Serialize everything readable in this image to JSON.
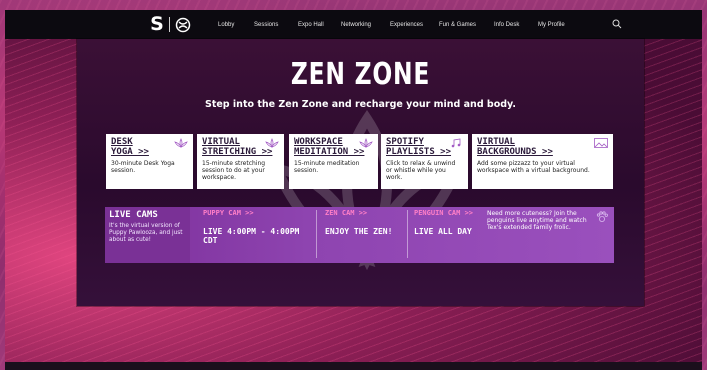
{
  "nav": {
    "items": [
      "Lobby",
      "Sessions",
      "Expo Hall",
      "Networking",
      "Experiences",
      "Fun & Games",
      "Info Desk",
      "My Profile"
    ],
    "logo_letter": "S"
  },
  "page": {
    "title": "ZEN ZONE",
    "subtitle": "Step into the Zen Zone and recharge your mind and body."
  },
  "cards": [
    {
      "title_line1": "DESK",
      "title_line2": "YOGA >>",
      "desc": "30-minute Desk Yoga session.",
      "icon": "lotus-icon"
    },
    {
      "title_line1": "VIRTUAL",
      "title_line2": "STRETCHING >>",
      "desc": "15-minute stretching session to do at your workspace.",
      "icon": "lotus-icon"
    },
    {
      "title_line1": "WORKSPACE",
      "title_line2": "MEDITATION >>",
      "desc": "15-minute meditation session.",
      "icon": "lotus-icon"
    },
    {
      "title_line1": "SPOTIFY",
      "title_line2": "PLAYLISTS >>",
      "desc": "Click to relax & unwind or whistle while you work.",
      "icon": "music-note-icon"
    },
    {
      "title_line1": "VIRTUAL",
      "title_line2": "BACKGROUNDS >>",
      "desc": "Add some pizzazz to your virtual workspace with a virtual background.",
      "icon": "image-icon"
    }
  ],
  "live_cams": {
    "title": "LIVE CAMS",
    "desc": "It's the virtual version of Puppy Pawlooza, and just about as cute!",
    "cams": [
      {
        "label": "PUPPY CAM >>",
        "sub": "LIVE 4:00PM - 4:00PM CDT"
      },
      {
        "label": "ZEN CAM >>",
        "sub": "ENJOY THE ZEN!"
      },
      {
        "label": "PENGUIN CAM >>",
        "sub": "LIVE ALL DAY"
      }
    ],
    "penguin_desc": "Need more cuteness? Join the penguins live anytime and watch Tex's extended family frolic."
  },
  "colors": {
    "nav_bg": "#0c0a10",
    "panel_bg": "#2a0a2d",
    "accent_pink": "#ff7fc7",
    "strip_purple": "#8e44b0"
  }
}
